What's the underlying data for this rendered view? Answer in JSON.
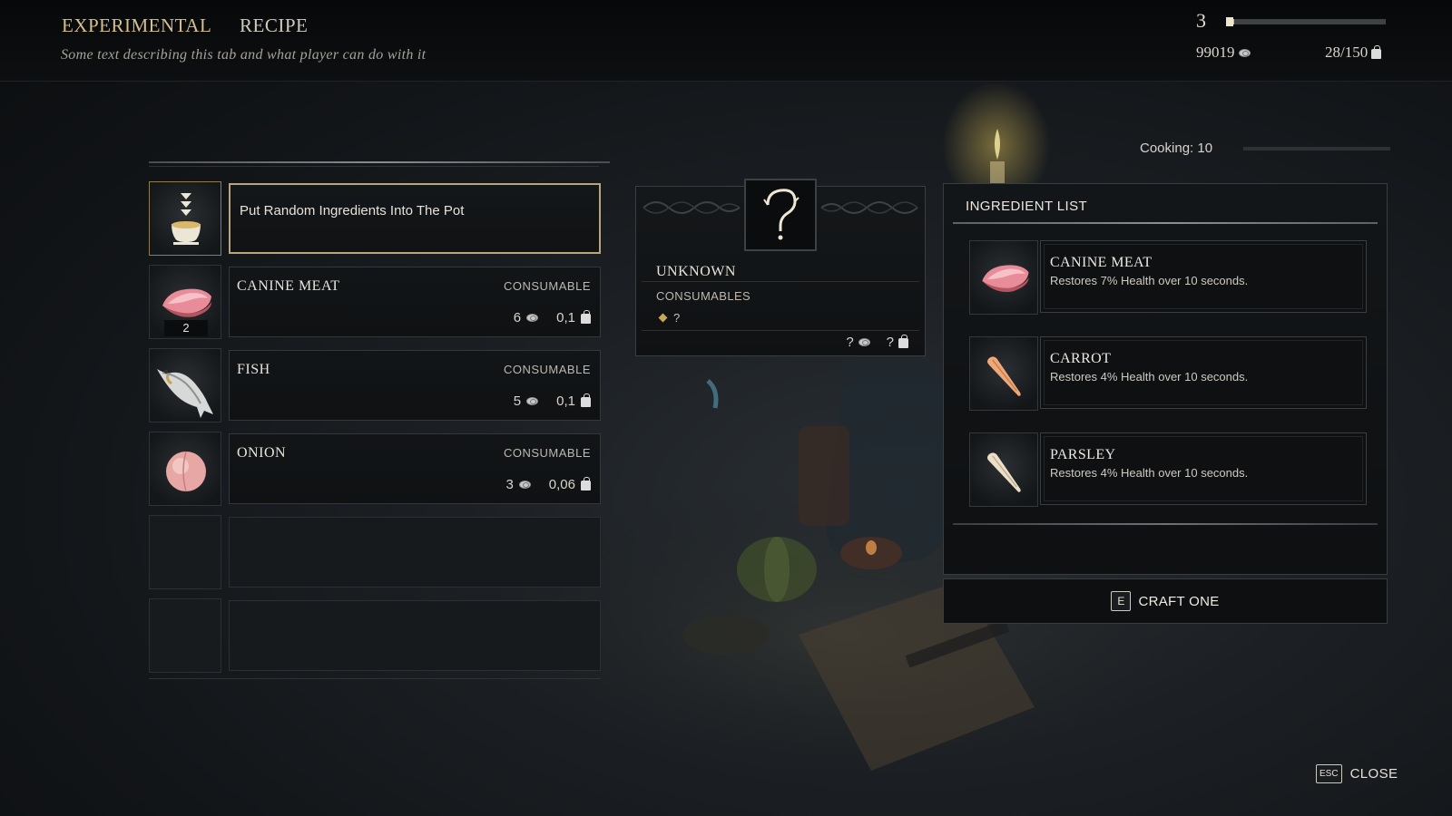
{
  "header": {
    "tabs": [
      {
        "label": "EXPERIMENTAL",
        "active": true
      },
      {
        "label": "RECIPE",
        "active": false
      }
    ],
    "description": "Some text describing this tab and what player can do with it",
    "level": "3",
    "level_progress": 0.05,
    "gold": "99019",
    "weight": "28/150"
  },
  "cooking": {
    "label": "Cooking: 10",
    "progress": 0.0
  },
  "left_list": {
    "random_action": {
      "label": "Put Random Ingredients Into The Pot",
      "icon": "pot-ingredients-icon"
    },
    "items": [
      {
        "name": "CANINE MEAT",
        "category": "CONSUMABLE",
        "price": "6",
        "weight": "0,1",
        "qty": "2",
        "icon": "meat-icon"
      },
      {
        "name": "FISH",
        "category": "CONSUMABLE",
        "price": "5",
        "weight": "0,1",
        "qty": "",
        "icon": "fish-icon"
      },
      {
        "name": "ONION",
        "category": "CONSUMABLE",
        "price": "3",
        "weight": "0,06",
        "qty": "",
        "icon": "onion-icon"
      }
    ]
  },
  "result": {
    "name": "UNKNOWN",
    "category": "CONSUMABLES",
    "rarity": "?",
    "price": "?",
    "weight": "?",
    "icon": "question-mark-icon"
  },
  "ingredient_list": {
    "title": "INGREDIENT LIST",
    "items": [
      {
        "name": "CANINE MEAT",
        "desc": "Restores 7% Health over 10 seconds.",
        "icon": "meat-icon"
      },
      {
        "name": "CARROT",
        "desc": "Restores 4% Health over 10 seconds.",
        "icon": "carrot-icon"
      },
      {
        "name": "PARSLEY",
        "desc": "Restores 4% Health over 10 seconds.",
        "icon": "parsley-root-icon"
      }
    ]
  },
  "actions": {
    "craft_key": "E",
    "craft_label": "CRAFT ONE",
    "close_key": "ESC",
    "close_label": "CLOSE"
  },
  "colors": {
    "accent_gold": "#d6bf8c",
    "active_border": "#b9a57b",
    "rarity_diamond": "#c9a65c"
  }
}
